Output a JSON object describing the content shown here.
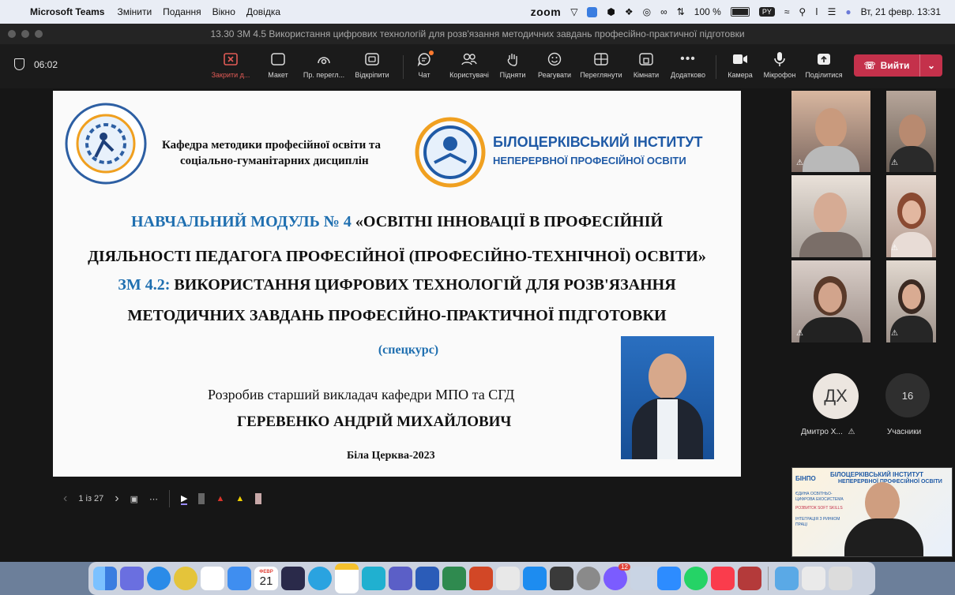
{
  "macos_menubar": {
    "app": "Microsoft Teams",
    "menus": [
      "Змінити",
      "Подання",
      "Вікно",
      "Довідка"
    ],
    "zoom_label": "zoom",
    "battery": "100 %",
    "keyboard": "PY",
    "datetime": "Вт, 21 февр. 13:31"
  },
  "window": {
    "title": "13.30 ЗМ 4.5 Використання цифрових технологій для розв'язання методичних завдань професійно-практичної підготовки"
  },
  "toolbar": {
    "timer": "06:02",
    "buttons": [
      {
        "icon": "close-share-icon",
        "label": "Закрити д...",
        "color": "#d9534f"
      },
      {
        "icon": "layout-icon",
        "label": "Макет"
      },
      {
        "icon": "presenter-view-icon",
        "label": "Пр. перегл..."
      },
      {
        "icon": "popout-icon",
        "label": "Відкріпити"
      },
      {
        "icon": "chat-icon",
        "label": "Чат",
        "dot": true
      },
      {
        "icon": "people-icon",
        "label": "Користувачі"
      },
      {
        "icon": "raise-hand-icon",
        "label": "Підняти"
      },
      {
        "icon": "react-icon",
        "label": "Реагувати"
      },
      {
        "icon": "view-icon",
        "label": "Переглянути"
      },
      {
        "icon": "rooms-icon",
        "label": "Кімнати"
      },
      {
        "icon": "more-icon",
        "label": "Додатково"
      },
      {
        "icon": "camera-icon",
        "label": "Камера"
      },
      {
        "icon": "microphone-icon",
        "label": "Мікрофон"
      },
      {
        "icon": "share-icon",
        "label": "Поділитися"
      }
    ],
    "leave_label": "Вийти"
  },
  "slide": {
    "dept_line1": "Кафедра методики професійної освіти та",
    "dept_line2": "соціально-гуманітарних дисциплін",
    "inst_line1": "БІЛОЦЕРКІВСЬКИЙ ІНСТИТУТ",
    "inst_line2": "НЕПЕРЕРВНОЇ ПРОФЕСІЙНОЇ ОСВІТИ",
    "module_prefix": "НАВЧАЛЬНИЙ МОДУЛЬ № 4",
    "module_rest": " «ОСВІТНІ ІННОВАЦІЇ В ПРОФЕСІЙНІЙ",
    "module_line2": "ДІЯЛЬНОСТІ ПЕДАГОГА ПРОФЕСІЙНОЇ (ПРОФЕСІЙНО-ТЕХНІЧНОЇ) ОСВІТИ»",
    "zm_prefix": "ЗМ 4.2:",
    "zm_rest": " ВИКОРИСТАННЯ ЦИФРОВИХ ТЕХНОЛОГІЙ ДЛЯ РОЗВ'ЯЗАННЯ",
    "zm_line2": "МЕТОДИЧНИХ ЗАВДАНЬ ПРОФЕСІЙНО-ПРАКТИЧНОЇ ПІДГОТОВКИ",
    "special": "(спецкурс)",
    "author_line1": "Розробив старший викладач кафедри МПО та СГД",
    "author_name": "ГЕРЕВЕНКО АНДРІЙ МИХАЙЛОВИЧ",
    "city_year": "Біла Церква-2023",
    "accent_color": "#1f6fb0"
  },
  "slide_controls": {
    "page": "1 із 27"
  },
  "participants": {
    "avatar_initials": "ДХ",
    "avatar_name": "Дмитро Х...",
    "count": "16",
    "count_label": "Учасники"
  },
  "self_view": {
    "inst_short": "БІНПО",
    "inst_line1": "БІЛОЦЕРКІВСЬКИЙ ІНСТИТУТ",
    "inst_line2": "НЕПЕРЕРВНОЇ ПРОФЕСІЙНОЇ ОСВІТИ",
    "items": [
      "ЄДИНА ОСВІТНЬО-ЦИФРОВА ЕКОСИСТЕМА",
      "РОЗВИТОК SOFT SKILLS",
      "ІНТЕГРАЦІЯ З РИНКОМ ПРАЦІ"
    ]
  },
  "dock": {
    "calendar_month": "ФЕВР",
    "calendar_day": "21",
    "badge": "12"
  }
}
